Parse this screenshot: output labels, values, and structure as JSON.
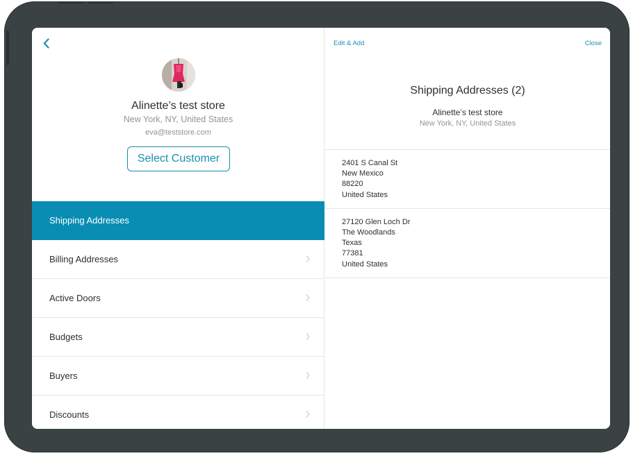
{
  "header": {
    "back_icon": "chevron-left-icon"
  },
  "customer": {
    "name": "Alinette’s test store",
    "location": "New York, NY, United States",
    "email": "eva@teststore.com",
    "select_label": "Select Customer"
  },
  "menu": {
    "items": [
      {
        "label": "Shipping Addresses",
        "active": true
      },
      {
        "label": "Billing Addresses",
        "active": false
      },
      {
        "label": "Active Doors",
        "active": false
      },
      {
        "label": "Budgets",
        "active": false
      },
      {
        "label": "Buyers",
        "active": false
      },
      {
        "label": "Discounts",
        "active": false
      }
    ]
  },
  "detail": {
    "edit_add_label": "Edit & Add",
    "close_label": "Close",
    "title": "Shipping Addresses (2)",
    "store_name": "Alinette’s test store",
    "store_location": "New York, NY, United States",
    "addresses": [
      [
        "2401 S Canal St",
        "New Mexico",
        "88220",
        "United States"
      ],
      [
        "27120 Glen Loch Dr",
        "The Woodlands",
        "Texas",
        "77381",
        "United States"
      ]
    ]
  },
  "colors": {
    "accent": "#1a8fb0",
    "active_row": "#0a8db3",
    "device_frame": "#3b4244"
  }
}
